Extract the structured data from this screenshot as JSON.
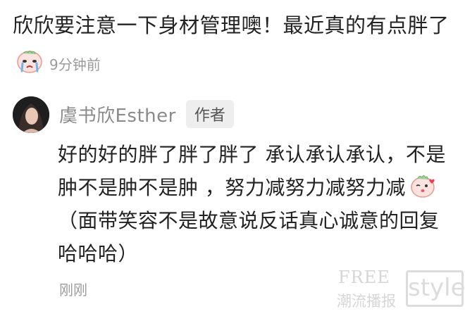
{
  "parent_comment": {
    "text_part1": "欣欣要注意一下身材管理噢！最近真的有点胖了",
    "emoji_icon": "crying-face-emoji-icon",
    "time": "9分钟前"
  },
  "reply": {
    "username": "虞书欣Esther",
    "author_badge": "作者",
    "text_part1": "好的好的胖了胖了胖了 承认承认承认，不是肿不是肿不是肿 ，努力减努力减努力减",
    "emoji_icon": "kissing-peach-emoji-icon",
    "text_part2": "（面带笑容不是故意说反话真心诚意的回复哈哈哈）",
    "time": "刚刚"
  },
  "watermark": {
    "free": "FREE",
    "subtitle": "潮流播报",
    "style": "style"
  },
  "colors": {
    "text": "#222222",
    "muted": "#9b9b9b",
    "username": "#8a8a8a",
    "badge_bg": "#eeeeee",
    "watermark": "#d6d6d6"
  }
}
